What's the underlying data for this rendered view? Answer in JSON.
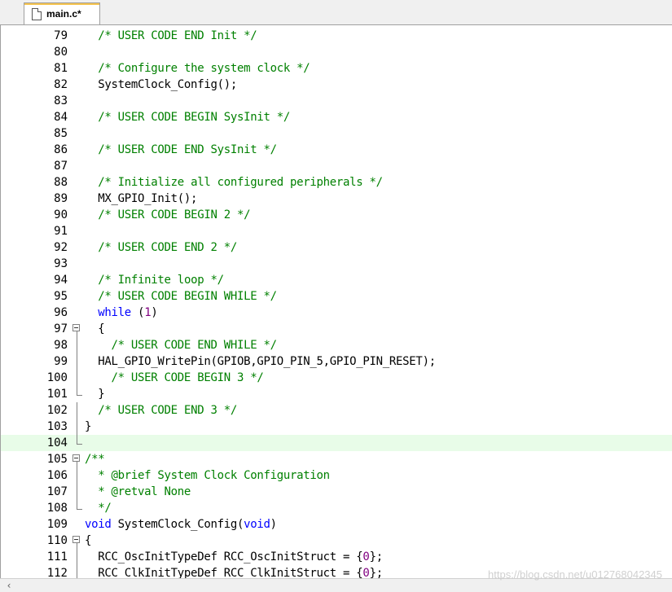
{
  "tab": {
    "label": "main.c*"
  },
  "lines": [
    {
      "n": "79",
      "segs": [
        {
          "t": "  "
        },
        {
          "t": "/* USER CODE END Init */",
          "c": "cm"
        }
      ]
    },
    {
      "n": "80",
      "segs": []
    },
    {
      "n": "81",
      "segs": [
        {
          "t": "  "
        },
        {
          "t": "/* Configure the system clock */",
          "c": "cm"
        }
      ]
    },
    {
      "n": "82",
      "segs": [
        {
          "t": "  SystemClock_Config();"
        }
      ]
    },
    {
      "n": "83",
      "segs": []
    },
    {
      "n": "84",
      "segs": [
        {
          "t": "  "
        },
        {
          "t": "/* USER CODE BEGIN SysInit */",
          "c": "cm"
        }
      ]
    },
    {
      "n": "85",
      "segs": []
    },
    {
      "n": "86",
      "segs": [
        {
          "t": "  "
        },
        {
          "t": "/* USER CODE END SysInit */",
          "c": "cm"
        }
      ]
    },
    {
      "n": "87",
      "segs": []
    },
    {
      "n": "88",
      "segs": [
        {
          "t": "  "
        },
        {
          "t": "/* Initialize all configured peripherals */",
          "c": "cm"
        }
      ]
    },
    {
      "n": "89",
      "segs": [
        {
          "t": "  MX_GPIO_Init();"
        }
      ]
    },
    {
      "n": "90",
      "segs": [
        {
          "t": "  "
        },
        {
          "t": "/* USER CODE BEGIN 2 */",
          "c": "cm"
        }
      ]
    },
    {
      "n": "91",
      "segs": []
    },
    {
      "n": "92",
      "segs": [
        {
          "t": "  "
        },
        {
          "t": "/* USER CODE END 2 */",
          "c": "cm"
        }
      ]
    },
    {
      "n": "93",
      "segs": []
    },
    {
      "n": "94",
      "segs": [
        {
          "t": "  "
        },
        {
          "t": "/* Infinite loop */",
          "c": "cm"
        }
      ]
    },
    {
      "n": "95",
      "segs": [
        {
          "t": "  "
        },
        {
          "t": "/* USER CODE BEGIN WHILE */",
          "c": "cm"
        }
      ]
    },
    {
      "n": "96",
      "segs": [
        {
          "t": "  "
        },
        {
          "t": "while",
          "c": "kw"
        },
        {
          "t": " ("
        },
        {
          "t": "1",
          "c": "num"
        },
        {
          "t": ")"
        }
      ]
    },
    {
      "n": "97",
      "segs": [
        {
          "t": "  {"
        }
      ]
    },
    {
      "n": "98",
      "segs": [
        {
          "t": "    "
        },
        {
          "t": "/* USER CODE END WHILE */",
          "c": "cm"
        }
      ]
    },
    {
      "n": "99",
      "segs": [
        {
          "t": "  HAL_GPIO_WritePin(GPIOB,GPIO_PIN_5,GPIO_PIN_RESET);"
        }
      ]
    },
    {
      "n": "100",
      "segs": [
        {
          "t": "    "
        },
        {
          "t": "/* USER CODE BEGIN 3 */",
          "c": "cm"
        }
      ]
    },
    {
      "n": "101",
      "segs": [
        {
          "t": "  }"
        }
      ]
    },
    {
      "n": "102",
      "segs": [
        {
          "t": "  "
        },
        {
          "t": "/* USER CODE END 3 */",
          "c": "cm"
        }
      ]
    },
    {
      "n": "103",
      "segs": [
        {
          "t": "}"
        }
      ]
    },
    {
      "n": "104",
      "segs": []
    },
    {
      "n": "105",
      "segs": [
        {
          "t": "/**",
          "c": "cm"
        }
      ]
    },
    {
      "n": "106",
      "segs": [
        {
          "t": "  * @brief System Clock Configuration",
          "c": "cm"
        }
      ]
    },
    {
      "n": "107",
      "segs": [
        {
          "t": "  * @retval None",
          "c": "cm"
        }
      ]
    },
    {
      "n": "108",
      "segs": [
        {
          "t": "  */",
          "c": "cm"
        }
      ]
    },
    {
      "n": "109",
      "segs": [
        {
          "t": "void",
          "c": "kw"
        },
        {
          "t": " SystemClock_Config("
        },
        {
          "t": "void",
          "c": "kw"
        },
        {
          "t": ")"
        }
      ]
    },
    {
      "n": "110",
      "segs": [
        {
          "t": "{"
        }
      ]
    },
    {
      "n": "111",
      "segs": [
        {
          "t": "  RCC_OscInitTypeDef RCC_OscInitStruct = {"
        },
        {
          "t": "0",
          "c": "num"
        },
        {
          "t": "};"
        }
      ]
    },
    {
      "n": "112",
      "segs": [
        {
          "t": "  RCC_ClkInitTypeDef RCC_ClkInitStruct = {"
        },
        {
          "t": "0",
          "c": "num"
        },
        {
          "t": "};"
        }
      ]
    }
  ],
  "current_line": "104",
  "fold_open": [
    "97",
    "105",
    "110"
  ],
  "fold_end": [
    "101",
    "104",
    "108"
  ],
  "fold_bar_lines": [
    "98",
    "99",
    "100",
    "102",
    "103",
    "106",
    "107",
    "111",
    "112"
  ],
  "watermark": "https://blog.csdn.net/u012768042345",
  "scroll_left_icon": "chevron-left-icon"
}
